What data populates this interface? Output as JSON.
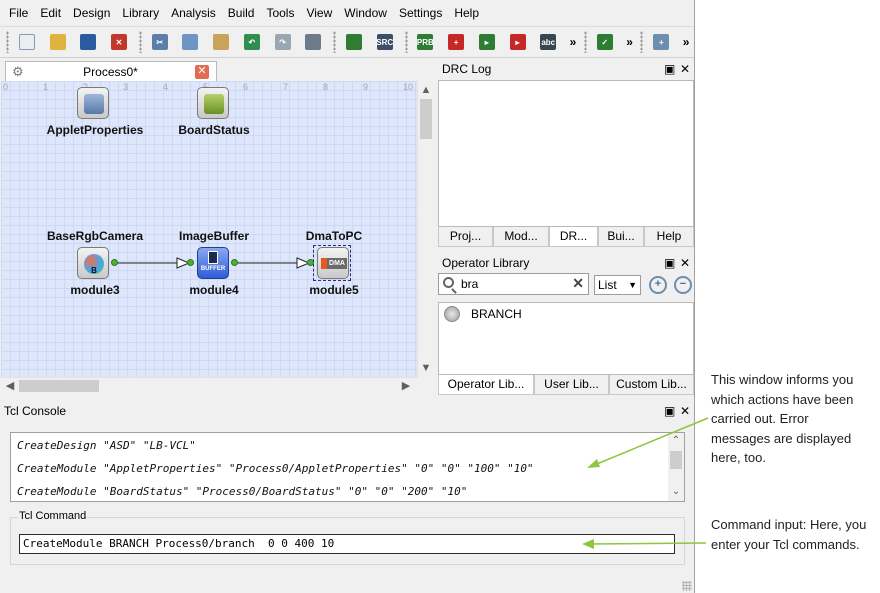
{
  "menu": [
    "File",
    "Edit",
    "Design",
    "Library",
    "Analysis",
    "Build",
    "Tools",
    "View",
    "Window",
    "Settings",
    "Help"
  ],
  "toolbar": {
    "buttons": [
      {
        "name": "new-file-icon",
        "color": "#e9eef5",
        "glyph": ""
      },
      {
        "name": "open-folder-icon",
        "color": "#e0b43c",
        "glyph": ""
      },
      {
        "name": "save-icon",
        "color": "#2c5aa0",
        "glyph": ""
      },
      {
        "name": "close-design-icon",
        "color": "#c0392b",
        "glyph": "✕"
      },
      {
        "name": "cut-icon",
        "color": "#5b7fa6",
        "glyph": "✂"
      },
      {
        "name": "copy-icon",
        "color": "#6f95c4",
        "glyph": ""
      },
      {
        "name": "paste-icon",
        "color": "#c9a45a",
        "glyph": ""
      },
      {
        "name": "undo-icon",
        "color": "#2f8f4e",
        "glyph": "↶"
      },
      {
        "name": "redo-icon",
        "color": "#9aa7b3",
        "glyph": "↷"
      },
      {
        "name": "delete-icon",
        "color": "#6e7b88",
        "glyph": ""
      },
      {
        "name": "resources-icon",
        "color": "#2e7d32",
        "glyph": ""
      },
      {
        "name": "source-icon",
        "color": "#3d4f66",
        "glyph": "SRC"
      },
      {
        "name": "probe-icon",
        "color": "#2e7d32",
        "glyph": "PRB"
      },
      {
        "name": "add-module-icon",
        "color": "#c62828",
        "glyph": "+"
      },
      {
        "name": "add-port-icon",
        "color": "#2e7d32",
        "glyph": "▸"
      },
      {
        "name": "remove-port-icon",
        "color": "#c62828",
        "glyph": "▸"
      },
      {
        "name": "text-icon",
        "color": "#37474f",
        "glyph": "abc"
      },
      {
        "name": "drc-check-icon",
        "color": "#2e7d32",
        "glyph": "✓"
      },
      {
        "name": "zoom-in-icon",
        "color": "#6c8fb0",
        "glyph": "+"
      }
    ],
    "more": "»"
  },
  "process_tab": {
    "label": "Process0*",
    "close": "✕"
  },
  "ruler": [
    "0",
    "1",
    "2",
    "3",
    "4",
    "5",
    "6",
    "7",
    "8",
    "9",
    "10"
  ],
  "modules": [
    {
      "title": "",
      "sub": "AppletProperties"
    },
    {
      "title": "",
      "sub": "BoardStatus"
    },
    {
      "title": "BaseRgbCamera",
      "sub": "module3",
      "icon_text": "B"
    },
    {
      "title": "ImageBuffer",
      "sub": "module4",
      "icon_text": "BUFFER"
    },
    {
      "title": "DmaToPC",
      "sub": "module5",
      "icon_text": "DMA"
    }
  ],
  "drc_log": {
    "title": "DRC Log",
    "tabs": [
      "Proj...",
      "Mod...",
      "DR...",
      "Bui...",
      "Help"
    ]
  },
  "operator_library": {
    "title": "Operator Library",
    "search_value": "bra",
    "view_select": "List",
    "items": [
      "BRANCH"
    ],
    "tabs": [
      "Operator Lib...",
      "User Lib...",
      "Custom Lib..."
    ]
  },
  "pane_controls": {
    "float": "▣",
    "close": "✕"
  },
  "tcl_console": {
    "title": "Tcl Console",
    "lines": [
      "CreateDesign \"ASD\" \"LB-VCL\"",
      "CreateModule \"AppletProperties\" \"Process0/AppletProperties\" \"0\" \"0\" \"100\" \"10\"",
      "CreateModule \"BoardStatus\" \"Process0/BoardStatus\" \"0\" \"0\" \"200\" \"10\""
    ],
    "command_label": "Tcl Command",
    "command_value": "CreateModule BRANCH Process0/branch  0 0 400 10"
  },
  "annotations": [
    {
      "text": "This window informs you which actions have been carried out. Error messages are displayed here, too."
    },
    {
      "text": "Command input: Here, you enter your Tcl commands."
    }
  ],
  "colors": {
    "accent_green": "#8dc63f",
    "canvas": "#dde6fb"
  }
}
